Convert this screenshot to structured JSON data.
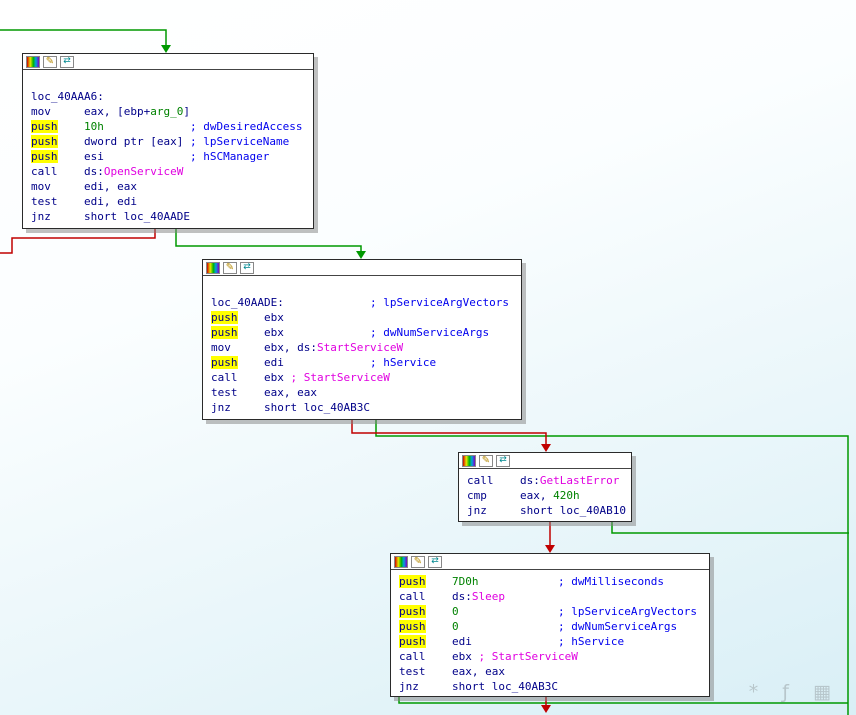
{
  "colors": {
    "edge_taken_green": "#009900",
    "edge_fallthrough_red": "#c00000",
    "code_text": "#000088",
    "immediate_green": "#008200",
    "api_name_magenta": "#e000e0",
    "comment_blue": "#0000ee",
    "token_highlight": "#ffff00",
    "node_background": "#ffffff"
  },
  "icons": {
    "color_swatch": "color-swatch-icon",
    "edit_glyph": "✎",
    "sync_glyph": "⇄"
  },
  "watermark": {
    "text": "* ƒ ▦"
  },
  "blocks": [
    {
      "label": "loc_40AAA6",
      "lines": [
        [],
        [
          {
            "t": "loc_40AAA6:",
            "c": "code"
          }
        ],
        [
          {
            "t": "mov     eax, [ebp+",
            "c": "code"
          },
          {
            "t": "arg_0",
            "c": "imm"
          },
          {
            "t": "]",
            "c": "code"
          }
        ],
        [
          {
            "t": "push",
            "c": "code",
            "h": true
          },
          {
            "t": "    ",
            "c": "code"
          },
          {
            "t": "10h",
            "c": "imm"
          },
          {
            "t": "             ",
            "c": "code"
          },
          {
            "t": "; dwDesiredAccess",
            "c": "cmt"
          }
        ],
        [
          {
            "t": "push",
            "c": "code",
            "h": true
          },
          {
            "t": "    dword ptr [eax] ",
            "c": "code"
          },
          {
            "t": "; lpServiceName",
            "c": "cmt"
          }
        ],
        [
          {
            "t": "push",
            "c": "code",
            "h": true
          },
          {
            "t": "    esi             ",
            "c": "code"
          },
          {
            "t": "; hSCManager",
            "c": "cmt"
          }
        ],
        [
          {
            "t": "call    ds:",
            "c": "code"
          },
          {
            "t": "OpenServiceW",
            "c": "api"
          }
        ],
        [
          {
            "t": "mov     edi, eax",
            "c": "code"
          }
        ],
        [
          {
            "t": "test    edi, edi",
            "c": "code"
          }
        ],
        [
          {
            "t": "jnz     short loc_40AADE",
            "c": "code"
          }
        ]
      ]
    },
    {
      "label": "loc_40AADE",
      "lines": [
        [],
        [
          {
            "t": "loc_40AADE:             ",
            "c": "code"
          },
          {
            "t": "; lpServiceArgVectors",
            "c": "cmt"
          }
        ],
        [
          {
            "t": "push",
            "c": "code",
            "h": true
          },
          {
            "t": "    ebx",
            "c": "code"
          }
        ],
        [
          {
            "t": "push",
            "c": "code",
            "h": true
          },
          {
            "t": "    ebx             ",
            "c": "code"
          },
          {
            "t": "; dwNumServiceArgs",
            "c": "cmt"
          }
        ],
        [
          {
            "t": "mov     ebx, ds:",
            "c": "code"
          },
          {
            "t": "StartServiceW",
            "c": "api"
          }
        ],
        [
          {
            "t": "push",
            "c": "code",
            "h": true
          },
          {
            "t": "    edi             ",
            "c": "code"
          },
          {
            "t": "; hService",
            "c": "cmt"
          }
        ],
        [
          {
            "t": "call    ebx ",
            "c": "code"
          },
          {
            "t": "; StartServiceW",
            "c": "api"
          }
        ],
        [
          {
            "t": "test    eax, eax",
            "c": "code"
          }
        ],
        [
          {
            "t": "jnz     short loc_40AB3C",
            "c": "code"
          }
        ]
      ]
    },
    {
      "label": "GetLastError block",
      "lines": [
        [
          {
            "t": "call    ds:",
            "c": "code"
          },
          {
            "t": "GetLastError",
            "c": "api"
          }
        ],
        [
          {
            "t": "cmp     eax, ",
            "c": "code"
          },
          {
            "t": "420h",
            "c": "imm"
          }
        ],
        [
          {
            "t": "jnz     short loc_40AB10",
            "c": "code"
          }
        ]
      ]
    },
    {
      "label": "Sleep retry block",
      "lines": [
        [
          {
            "t": "push",
            "c": "code",
            "h": true
          },
          {
            "t": "    ",
            "c": "code"
          },
          {
            "t": "7D0h",
            "c": "imm"
          },
          {
            "t": "            ",
            "c": "code"
          },
          {
            "t": "; dwMilliseconds",
            "c": "cmt"
          }
        ],
        [
          {
            "t": "call    ds:",
            "c": "code"
          },
          {
            "t": "Sleep",
            "c": "api"
          }
        ],
        [
          {
            "t": "push",
            "c": "code",
            "h": true
          },
          {
            "t": "    ",
            "c": "code"
          },
          {
            "t": "0",
            "c": "imm"
          },
          {
            "t": "               ",
            "c": "code"
          },
          {
            "t": "; lpServiceArgVectors",
            "c": "cmt"
          }
        ],
        [
          {
            "t": "push",
            "c": "code",
            "h": true
          },
          {
            "t": "    ",
            "c": "code"
          },
          {
            "t": "0",
            "c": "imm"
          },
          {
            "t": "               ",
            "c": "code"
          },
          {
            "t": "; dwNumServiceArgs",
            "c": "cmt"
          }
        ],
        [
          {
            "t": "push",
            "c": "code",
            "h": true
          },
          {
            "t": "    edi             ",
            "c": "code"
          },
          {
            "t": "; hService",
            "c": "cmt"
          }
        ],
        [
          {
            "t": "call    ebx ",
            "c": "code"
          },
          {
            "t": "; StartServiceW",
            "c": "api"
          }
        ],
        [
          {
            "t": "test    eax, eax",
            "c": "code"
          }
        ],
        [
          {
            "t": "jnz     short loc_40AB3C",
            "c": "code"
          }
        ]
      ]
    }
  ]
}
